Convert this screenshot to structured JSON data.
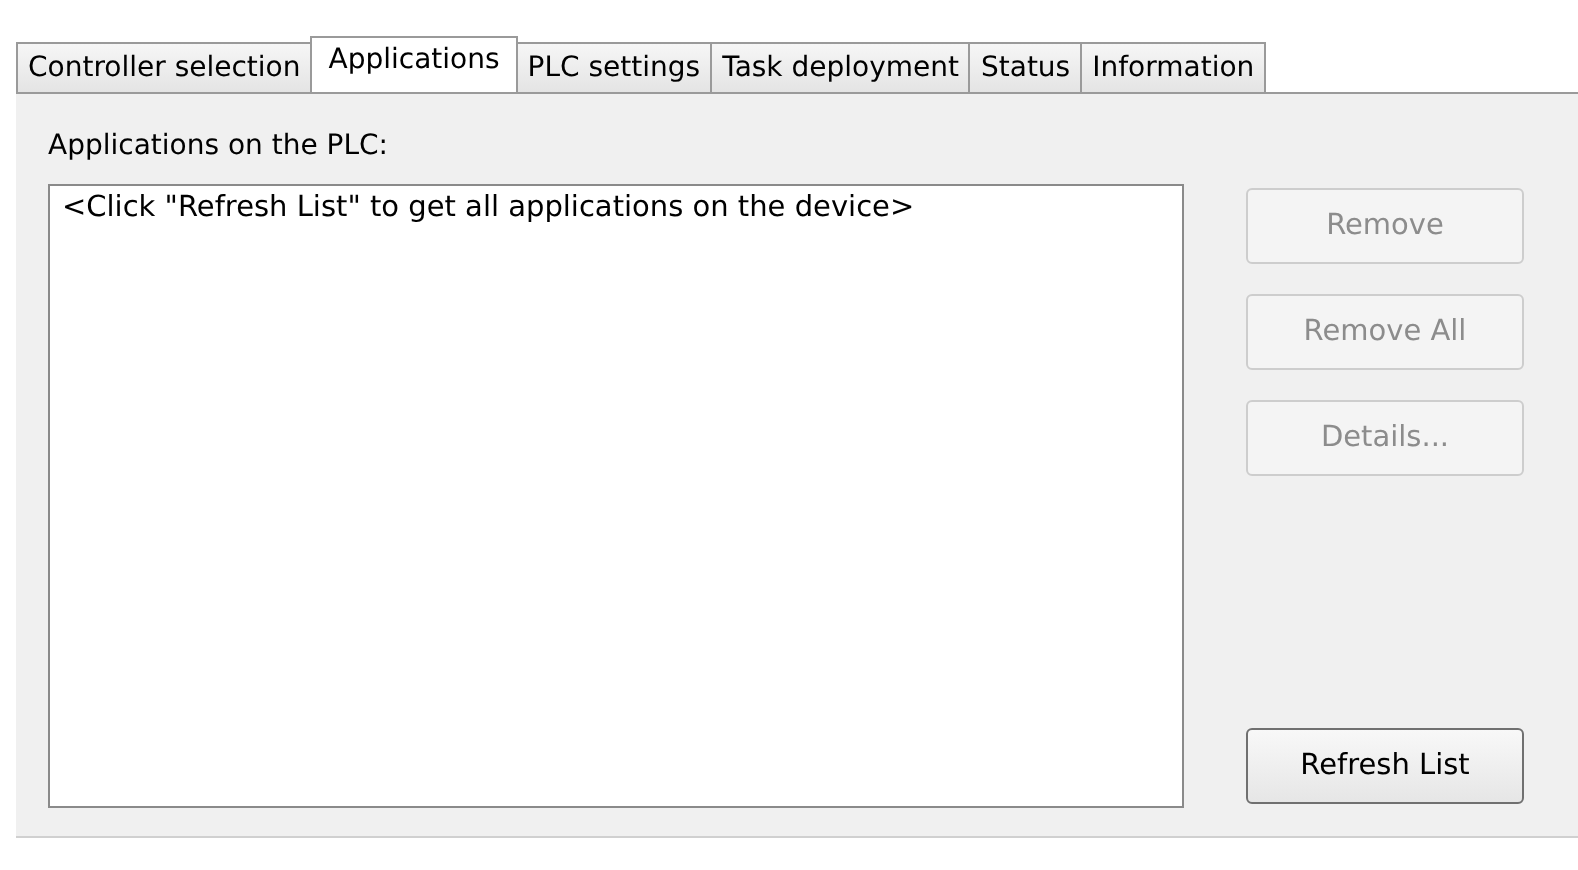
{
  "tabs": [
    {
      "label": "Controller selection",
      "selected": false
    },
    {
      "label": "Applications",
      "selected": true
    },
    {
      "label": "PLC settings",
      "selected": false
    },
    {
      "label": "Task deployment",
      "selected": false
    },
    {
      "label": "Status",
      "selected": false
    },
    {
      "label": "Information",
      "selected": false
    }
  ],
  "list_label": "Applications on the PLC:",
  "list": {
    "placeholder": "<Click \"Refresh List\" to get all applications on the device>"
  },
  "buttons": [
    {
      "label": "Remove",
      "disabled": true
    },
    {
      "label": "Remove All",
      "disabled": true
    },
    {
      "label": "Details...",
      "disabled": true
    }
  ],
  "refresh_button": {
    "label": "Refresh List",
    "disabled": false
  }
}
